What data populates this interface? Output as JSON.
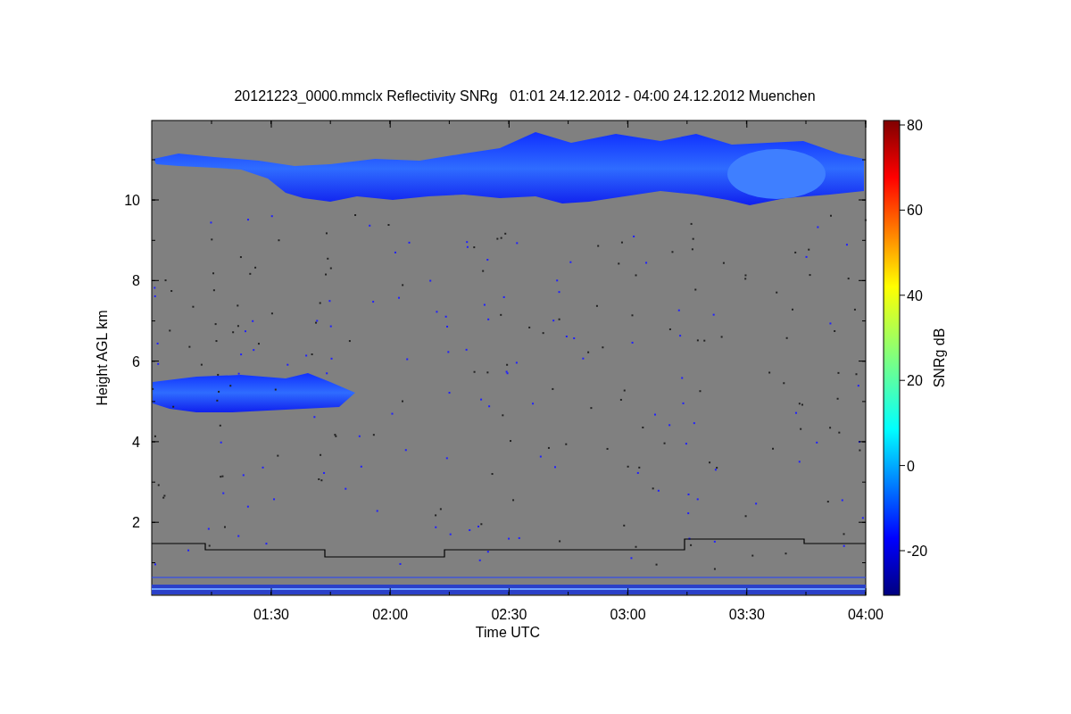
{
  "plot": {
    "title": "20121223_0000.mmclx Reflectivity SNRg   01:01 24.12.2012 - 04:00 24.12.2012 Muenchen",
    "y_axis": {
      "label": "Height AGL km",
      "ticks": [
        "10",
        "8",
        "6",
        "4",
        "2"
      ]
    },
    "x_axis": {
      "label": "Time UTC",
      "ticks": [
        "01:30",
        "02:00",
        "02:30",
        "03:00",
        "03:30",
        "04:00"
      ]
    },
    "colorbar": {
      "label": "SNRg dB",
      "ticks": [
        "80",
        "60",
        "40",
        "20",
        "0",
        "-20"
      ]
    }
  }
}
